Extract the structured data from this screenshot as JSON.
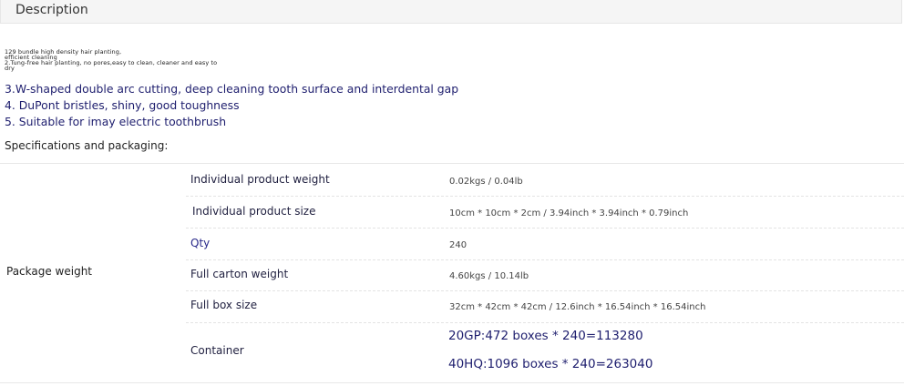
{
  "header": {
    "title": "Description"
  },
  "small_features": [
    "129 bundle high density hair planting,",
    "efficient cleaning",
    "2.Tung-free hair planting, no pores,easy to clean, cleaner and easy to",
    "dry"
  ],
  "features": [
    "3.W-shaped double arc cutting, deep cleaning tooth surface and interdental gap",
    "4. DuPont bristles, shiny, good toughness",
    "5. Suitable for imay electric toothbrush"
  ],
  "specs_title": "Specifications and packaging:",
  "table": {
    "group_label": "Package weight",
    "rows": [
      {
        "label": "Individual product weight",
        "value": "0.02kgs / 0.04lb"
      },
      {
        "label": "Individual product size",
        "value": "10cm * 10cm * 2cm / 3.94inch * 3.94inch * 0.79inch"
      },
      {
        "label": "Qty",
        "value": "240"
      },
      {
        "label": "Full carton weight",
        "value": "4.60kgs / 10.14lb"
      },
      {
        "label": "Full box size",
        "value": "32cm * 42cm * 42cm / 12.6inch * 16.54inch * 16.54inch"
      },
      {
        "label": "Container",
        "values": [
          "20GP:472 boxes * 240=113280",
          "40HQ:1096 boxes * 240=263040"
        ]
      }
    ]
  }
}
